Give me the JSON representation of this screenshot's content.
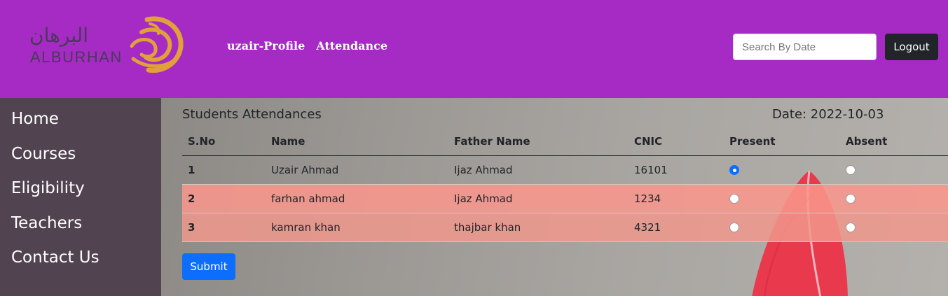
{
  "logo": {
    "arabic": "البرهان",
    "latin": "ALBURHAN"
  },
  "nav": [
    {
      "label": "uzair-Profile"
    },
    {
      "label": "Attendance"
    }
  ],
  "search": {
    "placeholder": "Search By Date",
    "value": ""
  },
  "logout_label": "Logout",
  "sidebar": {
    "items": [
      {
        "label": "Home"
      },
      {
        "label": "Courses"
      },
      {
        "label": "Eligibility"
      },
      {
        "label": "Teachers"
      },
      {
        "label": "Contact Us"
      }
    ]
  },
  "main": {
    "title": "Students Attendances",
    "date_label": "Date: 2022-10-03",
    "columns": [
      "S.No",
      "Name",
      "Father Name",
      "CNIC",
      "Present",
      "Absent"
    ],
    "rows": [
      {
        "sno": "1",
        "name": "Uzair Ahmad",
        "father": "Ijaz Ahmad",
        "cnic": "16101",
        "present": true,
        "absent": false
      },
      {
        "sno": "2",
        "name": "farhan ahmad",
        "father": "Ijaz Ahmad",
        "cnic": "1234",
        "present": false,
        "absent": false
      },
      {
        "sno": "3",
        "name": "kamran khan",
        "father": "thajbar khan",
        "cnic": "4321",
        "present": false,
        "absent": false
      }
    ],
    "submit_label": "Submit"
  },
  "colors": {
    "header": "#a62ac4",
    "sidebar": "#51434f",
    "primary": "#0d6efd",
    "dark": "#212529",
    "row_highlight": "#f4a095",
    "logo_gold": "#e0a03a"
  },
  "icons": {
    "logo_mark": "alburhan-swirl-icon",
    "background": "red-feather-image"
  }
}
